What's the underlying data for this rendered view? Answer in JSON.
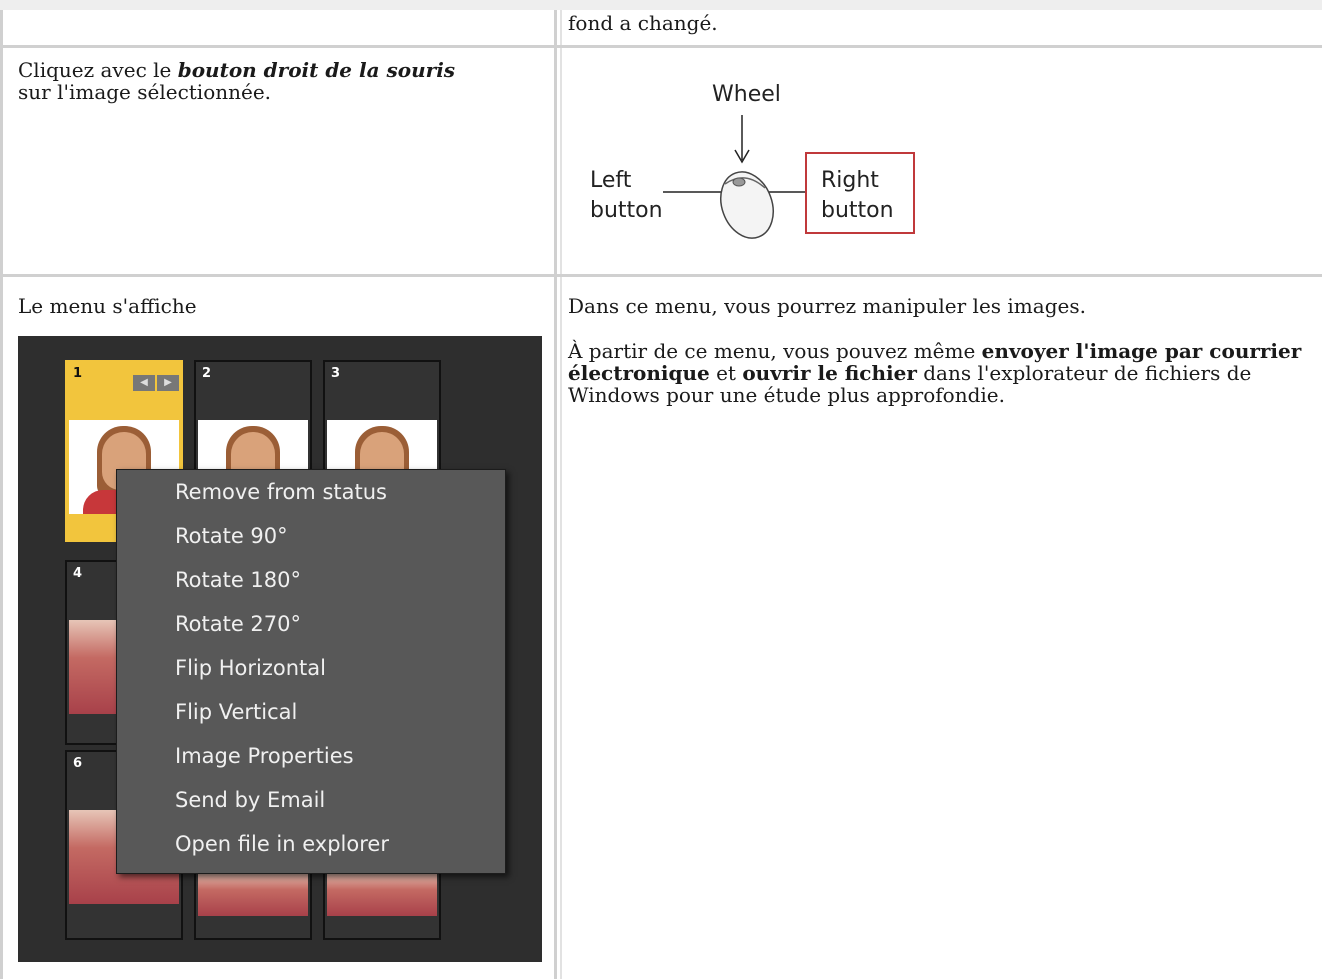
{
  "row0": {
    "right_text": "fond a changé."
  },
  "row1": {
    "left_pre": "Cliquez avec le ",
    "left_emph": "bouton droit de la souris",
    "left_post": "sur l'image sélectionnée.",
    "diagram": {
      "wheel": "Wheel",
      "left_line1": "Left",
      "left_line2": "button",
      "right_line1": "Right",
      "right_line2": "button"
    }
  },
  "row2": {
    "left_text": "Le menu s'affiche",
    "right_p1": "Dans ce menu, vous pourrez manipuler les images.",
    "right_p2_a": "À partir de ce menu, vous pouvez même ",
    "right_p2_b": "envoyer l'image par courrier électronique",
    "right_p2_c": " et ",
    "right_p2_d": "ouvrir le fichier",
    "right_p2_e": " dans l'explorateur de fichiers de Windows pour une étude plus approfondie."
  },
  "screenshot": {
    "thumbs": [
      "1",
      "2",
      "3",
      "4",
      "6"
    ],
    "menu_items": [
      "Remove from status",
      "Rotate 90°",
      "Rotate 180°",
      "Rotate 270°",
      "Flip Horizontal",
      "Flip Vertical",
      "Image Properties",
      "Send by Email",
      "Open file in explorer"
    ]
  },
  "colors": {
    "selected_thumb": "#f2c53d",
    "menu_bg": "#585858",
    "panel_bg": "#2e2e2e",
    "highlight_box": "#c0393b"
  }
}
